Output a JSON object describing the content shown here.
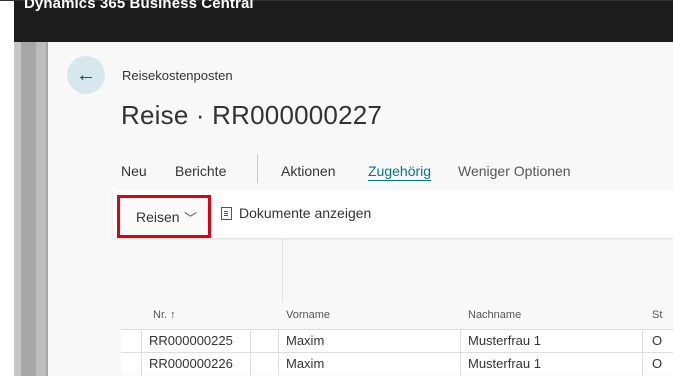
{
  "app": {
    "title": "Dynamics 365 Business Central"
  },
  "header": {
    "breadcrumb": "Reisekostenposten",
    "title": "Reise · RR000000227",
    "back_icon": "arrow-left-icon"
  },
  "actions": [
    {
      "label": "Neu"
    },
    {
      "label": "Berichte"
    },
    {
      "label": "Aktionen"
    },
    {
      "label": "Zugehörig",
      "active": true
    },
    {
      "label": "Weniger Optionen"
    }
  ],
  "subactions": {
    "reisen": {
      "label": "Reisen",
      "icon": "chevron-down-icon"
    },
    "documents": {
      "label": "Dokumente anzeigen",
      "icon": "document-icon"
    }
  },
  "table": {
    "columns": [
      "Nr. ↑",
      "Vorname",
      "Nachname",
      "St"
    ],
    "rows": [
      {
        "nr": "RR000000225",
        "vorname": "Maxim",
        "nachname": "Musterfrau 1",
        "st": "O"
      },
      {
        "nr": "RR000000226",
        "vorname": "Maxim",
        "nachname": "Musterfrau 1",
        "st": "O"
      }
    ]
  },
  "colors": {
    "accent": "#00778b",
    "highlight": "#e00016",
    "appbar": "#1c1c1c"
  }
}
